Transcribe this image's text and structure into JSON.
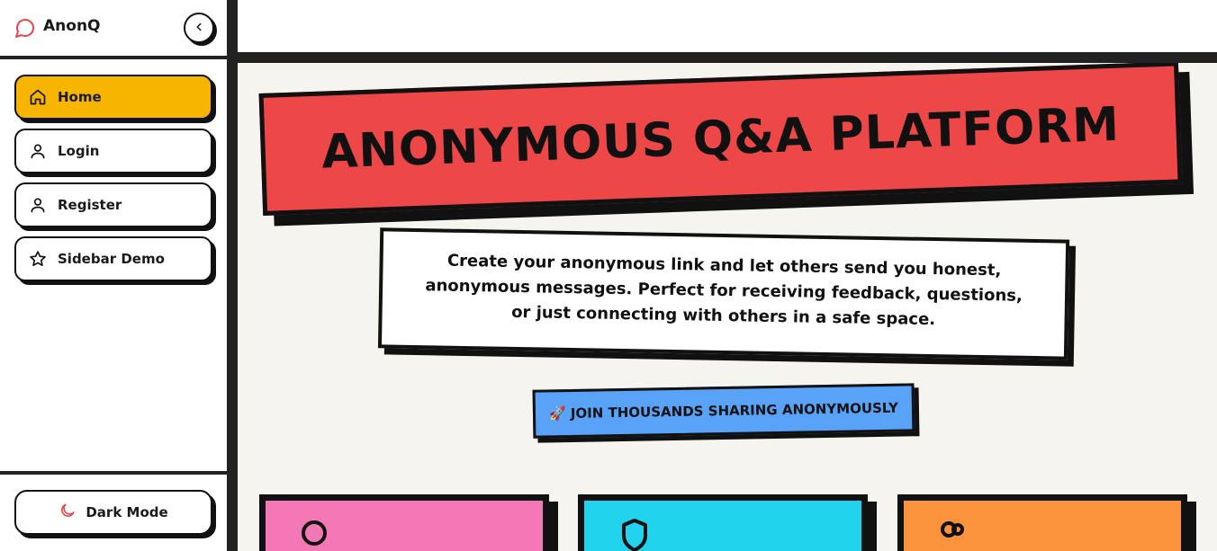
{
  "app": {
    "name": "AnonQ",
    "accent": "#ee4748"
  },
  "sidebar": {
    "items": [
      {
        "label": "Home",
        "icon": "home-icon",
        "active": true
      },
      {
        "label": "Login",
        "icon": "user-icon",
        "active": false
      },
      {
        "label": "Register",
        "icon": "user-icon",
        "active": false
      },
      {
        "label": "Sidebar Demo",
        "icon": "star-icon",
        "active": false
      }
    ],
    "dark_mode_label": "Dark Mode"
  },
  "hero": {
    "title": "ANONYMOUS Q&A PLATFORM",
    "description": "Create your anonymous link and let others send you honest, anonymous messages. Perfect for receiving feedback, questions, or just connecting with others in a safe space.",
    "badge": "🚀 JOIN THOUSANDS SHARING ANONYMOUSLY"
  },
  "cards": [
    {
      "icon": "search-icon",
      "color": "#f477b6"
    },
    {
      "icon": "shield-icon",
      "color": "#22d3ee"
    },
    {
      "icon": "users-icon",
      "color": "#fb923c"
    }
  ]
}
